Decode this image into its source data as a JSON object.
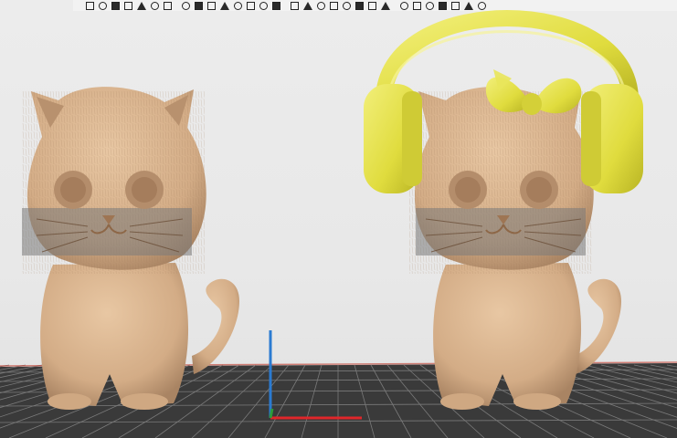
{
  "viewport": {
    "background": "#e8e8e8",
    "bed_color": "#3a3a3a",
    "bed_grid_color": "#7a7a7a",
    "bed_edge_color": "#c0392b"
  },
  "axes": {
    "x_color": "#e0262a",
    "y_color": "#2b7bd1",
    "z_color": "#2b9d3a"
  },
  "models": [
    {
      "name": "cat-model-left",
      "color": "#d9b48e",
      "shade": "#b08866",
      "accessories": []
    },
    {
      "name": "cat-model-right",
      "color": "#d9b48e",
      "shade": "#b08866",
      "accessories": [
        {
          "name": "headphones",
          "color": "#e6e34a"
        },
        {
          "name": "hair-bow",
          "color": "#e6e34a"
        }
      ]
    }
  ],
  "toolbar": {
    "icons": [
      "select-icon",
      "move-icon",
      "rotate-icon",
      "scale-icon",
      "cut-icon",
      "support-icon",
      "paint-icon",
      "measure-icon",
      "seam-icon",
      "view-icon",
      "arrange-icon",
      "orient-icon",
      "layer-icon",
      "split-icon",
      "merge-icon",
      "hollow-icon",
      "text-icon",
      "emboss-icon",
      "mirror-icon",
      "center-icon",
      "drop-icon",
      "copy-icon",
      "delete-icon",
      "undo-icon",
      "redo-icon",
      "grid-icon",
      "camera-icon",
      "zoom-icon",
      "slice-icon",
      "export-icon"
    ]
  }
}
